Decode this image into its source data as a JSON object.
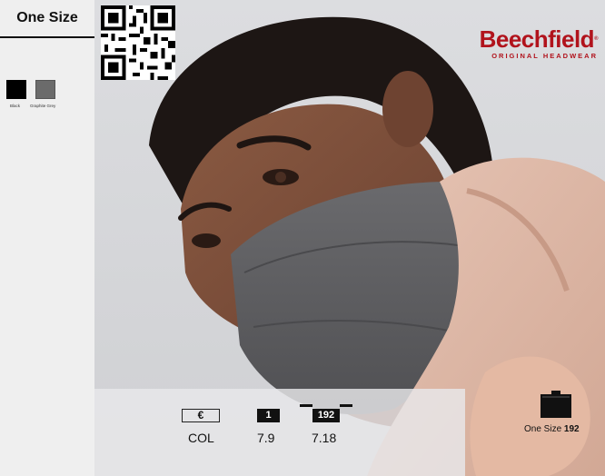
{
  "sidebar": {
    "size_title": "One Size",
    "colours": [
      {
        "label": "Black",
        "hex": "#000000"
      },
      {
        "label": "Graphite Grey",
        "hex": "#6b6b6b"
      }
    ]
  },
  "brand": {
    "name": "Beechfield",
    "tagline": "ORIGINAL HEADWEAR",
    "color": "#b1131c"
  },
  "pricing": {
    "currency_symbol": "€",
    "quantities": [
      "1",
      "192"
    ],
    "row_label": "COL",
    "prices": [
      "7.9",
      "7.18"
    ]
  },
  "carton": {
    "size": "One Size",
    "quantity": "192"
  }
}
